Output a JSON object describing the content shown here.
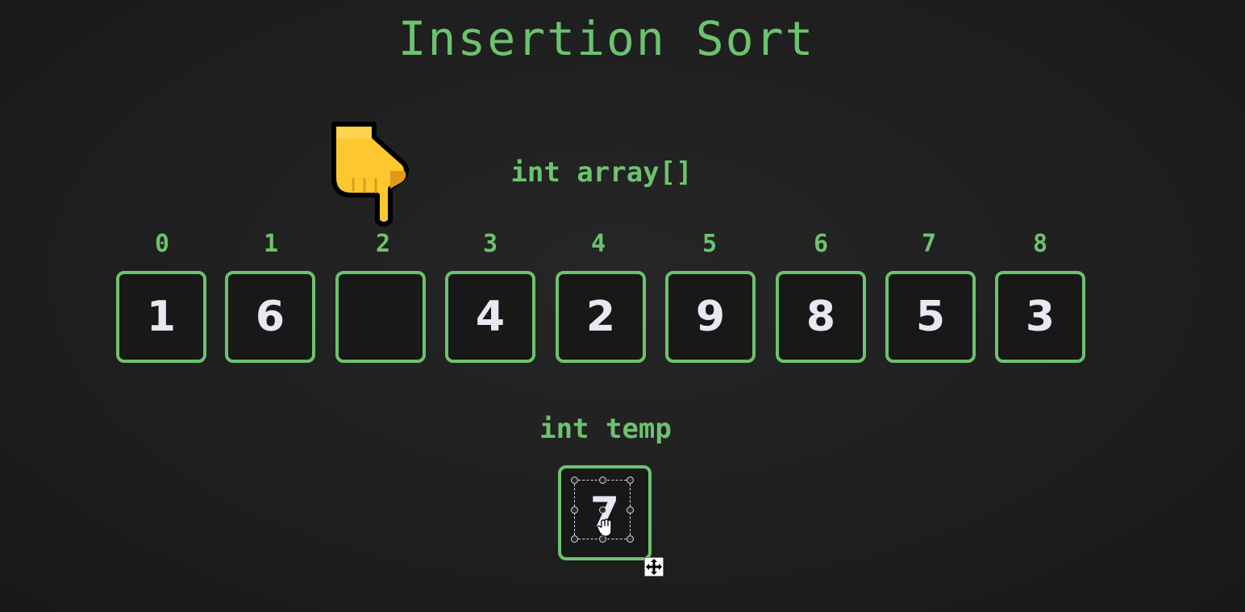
{
  "title": "Insertion Sort",
  "array_label": "int array[]",
  "indices": [
    "0",
    "1",
    "2",
    "3",
    "4",
    "5",
    "6",
    "7",
    "8"
  ],
  "cells": [
    "1",
    "6",
    "",
    "4",
    "2",
    "9",
    "8",
    "5",
    "3"
  ],
  "temp_label": "int temp",
  "temp_value": "7",
  "pointer": {
    "icon": "pointing-down-hand-icon",
    "target_index": 2
  },
  "colors": {
    "accent": "#6cc36e",
    "background": "#1f1f1f",
    "value_text": "#e9e7f2",
    "pointer": "#fdc82f"
  }
}
